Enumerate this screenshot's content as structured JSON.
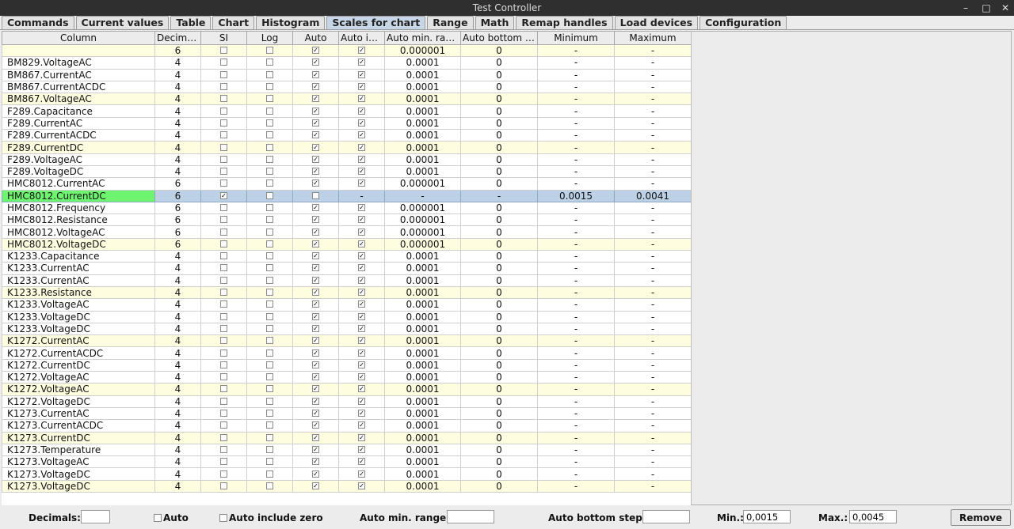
{
  "window": {
    "title": "Test Controller"
  },
  "tabs": [
    {
      "label": "Commands",
      "active": false
    },
    {
      "label": "Current values",
      "active": false
    },
    {
      "label": "Table",
      "active": false
    },
    {
      "label": "Chart",
      "active": false
    },
    {
      "label": "Histogram",
      "active": false
    },
    {
      "label": "Scales for chart",
      "active": true
    },
    {
      "label": "Range",
      "active": false
    },
    {
      "label": "Math",
      "active": false
    },
    {
      "label": "Remap handles",
      "active": false
    },
    {
      "label": "Load devices",
      "active": false
    },
    {
      "label": "Configuration",
      "active": false
    }
  ],
  "table": {
    "columns": [
      "Column",
      "Decimals",
      "SI",
      "Log",
      "Auto",
      "Auto inc...",
      "Auto min. range",
      "Auto bottom st...",
      "Minimum",
      "Maximum"
    ],
    "rows": [
      {
        "name": "",
        "decimals": "6",
        "si": false,
        "log": false,
        "auto": true,
        "autoinc": true,
        "minrange": "0.000001",
        "bottom": "0",
        "min": "-",
        "max": "-",
        "hl": true
      },
      {
        "name": "BM829.VoltageAC",
        "decimals": "4",
        "si": false,
        "log": false,
        "auto": true,
        "autoinc": true,
        "minrange": "0.0001",
        "bottom": "0",
        "min": "-",
        "max": "-"
      },
      {
        "name": "BM867.CurrentAC",
        "decimals": "4",
        "si": false,
        "log": false,
        "auto": true,
        "autoinc": true,
        "minrange": "0.0001",
        "bottom": "0",
        "min": "-",
        "max": "-"
      },
      {
        "name": "BM867.CurrentACDC",
        "decimals": "4",
        "si": false,
        "log": false,
        "auto": true,
        "autoinc": true,
        "minrange": "0.0001",
        "bottom": "0",
        "min": "-",
        "max": "-"
      },
      {
        "name": "BM867.VoltageAC",
        "decimals": "4",
        "si": false,
        "log": false,
        "auto": true,
        "autoinc": true,
        "minrange": "0.0001",
        "bottom": "0",
        "min": "-",
        "max": "-",
        "hl": true
      },
      {
        "name": "F289.Capacitance",
        "decimals": "4",
        "si": false,
        "log": false,
        "auto": true,
        "autoinc": true,
        "minrange": "0.0001",
        "bottom": "0",
        "min": "-",
        "max": "-"
      },
      {
        "name": "F289.CurrentAC",
        "decimals": "4",
        "si": false,
        "log": false,
        "auto": true,
        "autoinc": true,
        "minrange": "0.0001",
        "bottom": "0",
        "min": "-",
        "max": "-"
      },
      {
        "name": "F289.CurrentACDC",
        "decimals": "4",
        "si": false,
        "log": false,
        "auto": true,
        "autoinc": true,
        "minrange": "0.0001",
        "bottom": "0",
        "min": "-",
        "max": "-"
      },
      {
        "name": "F289.CurrentDC",
        "decimals": "4",
        "si": false,
        "log": false,
        "auto": true,
        "autoinc": true,
        "minrange": "0.0001",
        "bottom": "0",
        "min": "-",
        "max": "-",
        "hl": true
      },
      {
        "name": "F289.VoltageAC",
        "decimals": "4",
        "si": false,
        "log": false,
        "auto": true,
        "autoinc": true,
        "minrange": "0.0001",
        "bottom": "0",
        "min": "-",
        "max": "-"
      },
      {
        "name": "F289.VoltageDC",
        "decimals": "4",
        "si": false,
        "log": false,
        "auto": true,
        "autoinc": true,
        "minrange": "0.0001",
        "bottom": "0",
        "min": "-",
        "max": "-"
      },
      {
        "name": "HMC8012.CurrentAC",
        "decimals": "6",
        "si": false,
        "log": false,
        "auto": true,
        "autoinc": true,
        "minrange": "0.000001",
        "bottom": "0",
        "min": "-",
        "max": "-"
      },
      {
        "name": "HMC8012.CurrentDC",
        "decimals": "6",
        "si": true,
        "log": false,
        "auto": false,
        "autoinc": null,
        "minrange": "-",
        "bottom": "-",
        "min": "0.0015",
        "max": "0.0041",
        "sel": true
      },
      {
        "name": "HMC8012.Frequency",
        "decimals": "6",
        "si": false,
        "log": false,
        "auto": true,
        "autoinc": true,
        "minrange": "0.000001",
        "bottom": "0",
        "min": "-",
        "max": "-"
      },
      {
        "name": "HMC8012.Resistance",
        "decimals": "6",
        "si": false,
        "log": false,
        "auto": true,
        "autoinc": true,
        "minrange": "0.000001",
        "bottom": "0",
        "min": "-",
        "max": "-"
      },
      {
        "name": "HMC8012.VoltageAC",
        "decimals": "6",
        "si": false,
        "log": false,
        "auto": true,
        "autoinc": true,
        "minrange": "0.000001",
        "bottom": "0",
        "min": "-",
        "max": "-"
      },
      {
        "name": "HMC8012.VoltageDC",
        "decimals": "6",
        "si": false,
        "log": false,
        "auto": true,
        "autoinc": true,
        "minrange": "0.000001",
        "bottom": "0",
        "min": "-",
        "max": "-",
        "hl": true
      },
      {
        "name": "K1233.Capacitance",
        "decimals": "4",
        "si": false,
        "log": false,
        "auto": true,
        "autoinc": true,
        "minrange": "0.0001",
        "bottom": "0",
        "min": "-",
        "max": "-"
      },
      {
        "name": "K1233.CurrentAC",
        "decimals": "4",
        "si": false,
        "log": false,
        "auto": true,
        "autoinc": true,
        "minrange": "0.0001",
        "bottom": "0",
        "min": "-",
        "max": "-"
      },
      {
        "name": "K1233.CurrentAC",
        "decimals": "4",
        "si": false,
        "log": false,
        "auto": true,
        "autoinc": true,
        "minrange": "0.0001",
        "bottom": "0",
        "min": "-",
        "max": "-"
      },
      {
        "name": "K1233.Resistance",
        "decimals": "4",
        "si": false,
        "log": false,
        "auto": true,
        "autoinc": true,
        "minrange": "0.0001",
        "bottom": "0",
        "min": "-",
        "max": "-",
        "hl": true
      },
      {
        "name": "K1233.VoltageAC",
        "decimals": "4",
        "si": false,
        "log": false,
        "auto": true,
        "autoinc": true,
        "minrange": "0.0001",
        "bottom": "0",
        "min": "-",
        "max": "-"
      },
      {
        "name": "K1233.VoltageDC",
        "decimals": "4",
        "si": false,
        "log": false,
        "auto": true,
        "autoinc": true,
        "minrange": "0.0001",
        "bottom": "0",
        "min": "-",
        "max": "-"
      },
      {
        "name": "K1233.VoltageDC",
        "decimals": "4",
        "si": false,
        "log": false,
        "auto": true,
        "autoinc": true,
        "minrange": "0.0001",
        "bottom": "0",
        "min": "-",
        "max": "-"
      },
      {
        "name": "K1272.CurrentAC",
        "decimals": "4",
        "si": false,
        "log": false,
        "auto": true,
        "autoinc": true,
        "minrange": "0.0001",
        "bottom": "0",
        "min": "-",
        "max": "-",
        "hl": true
      },
      {
        "name": "K1272.CurrentACDC",
        "decimals": "4",
        "si": false,
        "log": false,
        "auto": true,
        "autoinc": true,
        "minrange": "0.0001",
        "bottom": "0",
        "min": "-",
        "max": "-"
      },
      {
        "name": "K1272.CurrentDC",
        "decimals": "4",
        "si": false,
        "log": false,
        "auto": true,
        "autoinc": true,
        "minrange": "0.0001",
        "bottom": "0",
        "min": "-",
        "max": "-"
      },
      {
        "name": "K1272.VoltageAC",
        "decimals": "4",
        "si": false,
        "log": false,
        "auto": true,
        "autoinc": true,
        "minrange": "0.0001",
        "bottom": "0",
        "min": "-",
        "max": "-"
      },
      {
        "name": "K1272.VoltageAC",
        "decimals": "4",
        "si": false,
        "log": false,
        "auto": true,
        "autoinc": true,
        "minrange": "0.0001",
        "bottom": "0",
        "min": "-",
        "max": "-",
        "hl": true
      },
      {
        "name": "K1272.VoltageDC",
        "decimals": "4",
        "si": false,
        "log": false,
        "auto": true,
        "autoinc": true,
        "minrange": "0.0001",
        "bottom": "0",
        "min": "-",
        "max": "-"
      },
      {
        "name": "K1273.CurrentAC",
        "decimals": "4",
        "si": false,
        "log": false,
        "auto": true,
        "autoinc": true,
        "minrange": "0.0001",
        "bottom": "0",
        "min": "-",
        "max": "-"
      },
      {
        "name": "K1273.CurrentACDC",
        "decimals": "4",
        "si": false,
        "log": false,
        "auto": true,
        "autoinc": true,
        "minrange": "0.0001",
        "bottom": "0",
        "min": "-",
        "max": "-"
      },
      {
        "name": "K1273.CurrentDC",
        "decimals": "4",
        "si": false,
        "log": false,
        "auto": true,
        "autoinc": true,
        "minrange": "0.0001",
        "bottom": "0",
        "min": "-",
        "max": "-",
        "hl": true
      },
      {
        "name": "K1273.Temperature",
        "decimals": "4",
        "si": false,
        "log": false,
        "auto": true,
        "autoinc": true,
        "minrange": "0.0001",
        "bottom": "0",
        "min": "-",
        "max": "-"
      },
      {
        "name": "K1273.VoltageAC",
        "decimals": "4",
        "si": false,
        "log": false,
        "auto": true,
        "autoinc": true,
        "minrange": "0.0001",
        "bottom": "0",
        "min": "-",
        "max": "-"
      },
      {
        "name": "K1273.VoltageDC",
        "decimals": "4",
        "si": false,
        "log": false,
        "auto": true,
        "autoinc": true,
        "minrange": "0.0001",
        "bottom": "0",
        "min": "-",
        "max": "-"
      },
      {
        "name": "K1273.VoltageDC",
        "decimals": "4",
        "si": false,
        "log": false,
        "auto": true,
        "autoinc": true,
        "minrange": "0.0001",
        "bottom": "0",
        "min": "-",
        "max": "-",
        "hl": true
      }
    ]
  },
  "bottom": {
    "decimals_label": "Decimals:",
    "decimals_value": "",
    "auto_label": "Auto",
    "auto_include_zero_label": "Auto include zero",
    "auto_min_range_label": "Auto min. range:",
    "auto_min_range_value": "",
    "auto_bottom_step_label": "Auto bottom step:",
    "auto_bottom_step_value": "",
    "min_label": "Min.:",
    "min_value": "0,0015",
    "max_label": "Max.:",
    "max_value": "0,0045",
    "remove_label": "Remove"
  },
  "colors": {
    "selected_row": "#bcd0e6",
    "selected_name_cell": "#6ef46e",
    "highlight_row": "#fffde0",
    "active_tab": "#c7d6e6"
  }
}
